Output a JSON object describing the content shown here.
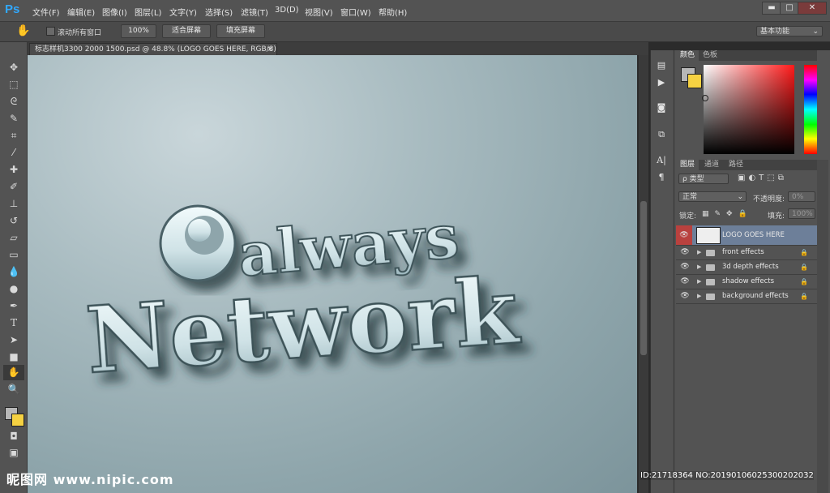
{
  "app": {
    "logo": "Ps"
  },
  "menu": [
    "文件(F)",
    "编辑(E)",
    "图像(I)",
    "图层(L)",
    "文字(Y)",
    "选择(S)",
    "滤镜(T)",
    "3D(D)",
    "视图(V)",
    "窗口(W)",
    "帮助(H)"
  ],
  "window_controls": {
    "minimize": "▬",
    "maximize": "□",
    "close": "✕"
  },
  "options": {
    "scroll_all_label": "滚动所有窗口",
    "btn_100": "100%",
    "btn_fit": "适合屏幕",
    "btn_fill": "填充屏幕",
    "workspace": "基本功能"
  },
  "document": {
    "tab_title": "标志样机3300 2000 1500.psd @ 48.8% (LOGO GOES HERE, RGB/8)",
    "tab_close": "×"
  },
  "artwork": {
    "line1": "always",
    "line2": "Network"
  },
  "color_panel": {
    "tabs": [
      "颜色",
      "色板"
    ],
    "foreground": "#b7b7b7",
    "background": "#f5d142"
  },
  "layers_panel": {
    "tabs": [
      "图层",
      "通道",
      "路径"
    ],
    "filter_label": "ρ 类型",
    "blend_mode": "正常",
    "opacity_label": "不透明度:",
    "opacity_value": "0%",
    "lock_label": "锁定:",
    "fill_label": "填充:",
    "fill_value": "100%",
    "layers": [
      {
        "name": "LOGO GOES HERE",
        "type": "smart",
        "selected": true,
        "locked": false
      },
      {
        "name": "front effects",
        "type": "group",
        "selected": false,
        "locked": true
      },
      {
        "name": "3d depth effects",
        "type": "group",
        "selected": false,
        "locked": true
      },
      {
        "name": "shadow effects",
        "type": "group",
        "selected": false,
        "locked": true
      },
      {
        "name": "background effects",
        "type": "group",
        "selected": false,
        "locked": true
      }
    ]
  },
  "watermark": {
    "site": "昵图网 www.nipic.com",
    "id_text": "ID:21718364 NO:20190106025300202032"
  },
  "colors": {
    "accent_selected": "#6d7f99",
    "eye_highlight": "#b9413e"
  }
}
